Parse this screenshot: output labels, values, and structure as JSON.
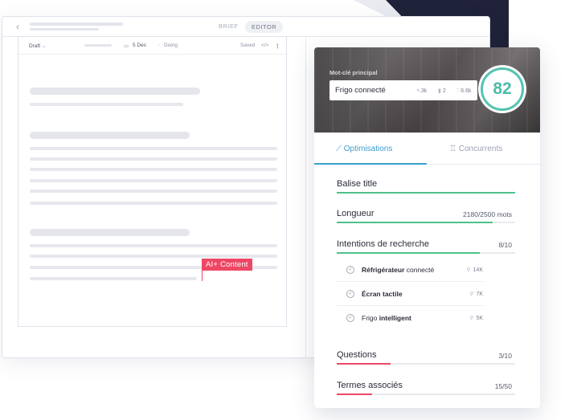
{
  "editor": {
    "tabs": {
      "brief": "BRIEF",
      "editor": "EDITOR"
    },
    "doc_toolbar": {
      "status": "Draft",
      "date": "5 Dec",
      "state": "Doing",
      "saved": "Saved",
      "code_icon": "</>",
      "menu_icon": "⋮"
    },
    "ai_badge": "AI+ Content"
  },
  "panel": {
    "hero_label": "Mot-clé principal",
    "keyword": "Frigo connecté",
    "keyword_stats": {
      "stat1": "3k",
      "stat2": "2",
      "stat3": "6.6k"
    },
    "score": "82",
    "tabs": {
      "optimisations": "Optimisations",
      "concurrents": "Concurrents"
    },
    "sections": {
      "balise": {
        "title": "Balise title",
        "progress": 1.0,
        "color": "#4cc28a"
      },
      "longueur": {
        "title": "Longueur",
        "value": "2180/2500 mots",
        "progress": 0.872,
        "color": "#4cc28a"
      },
      "intentions": {
        "title": "Intentions de recherche",
        "value": "8/10",
        "progress": 0.8,
        "color": "#4cc28a",
        "items": [
          {
            "bold": "Réfrigérateur",
            "rest": " connecté",
            "volume": "14K"
          },
          {
            "bold": "Écran tactile",
            "rest": "",
            "volume": "7K"
          },
          {
            "pre": "Frigo ",
            "bold": "intelligent",
            "volume": "5K"
          }
        ]
      },
      "questions": {
        "title": "Questions",
        "value": "3/10",
        "progress": 0.3,
        "color": "#ee4766"
      },
      "termes": {
        "title": "Termes associés",
        "value": "15/50",
        "progress": 0.2,
        "color": "#ee4766"
      }
    }
  }
}
